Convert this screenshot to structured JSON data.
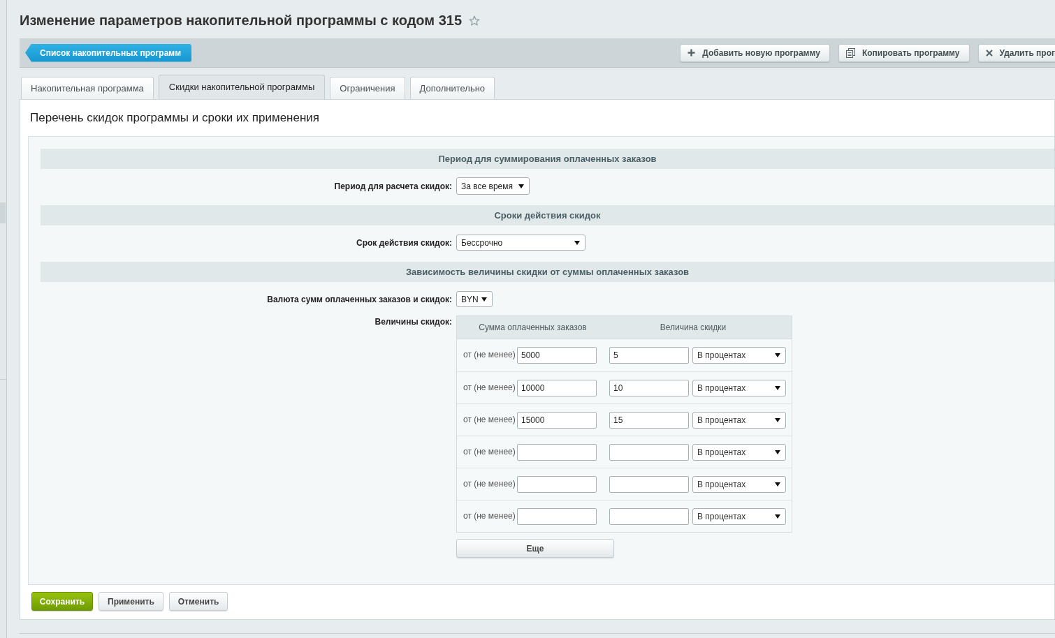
{
  "page": {
    "title": "Изменение параметров накопительной программы с кодом 315"
  },
  "toolbar": {
    "back_button": "Список накопительных программ",
    "actions": [
      {
        "kind": "add",
        "label": "Добавить новую программу"
      },
      {
        "kind": "copy",
        "label": "Копировать программу"
      },
      {
        "kind": "delete",
        "label": "Удалить прог"
      }
    ]
  },
  "tabs": [
    {
      "label": "Накопительная программа",
      "selected": false
    },
    {
      "label": "Скидки накопительной программы",
      "selected": true
    },
    {
      "label": "Ограничения",
      "selected": false
    },
    {
      "label": "Дополнительно",
      "selected": false
    }
  ],
  "panel": {
    "heading": "Перечень скидок программы и сроки их применения",
    "sections": [
      {
        "title": "Период для суммирования оплаченных заказов",
        "fields": [
          {
            "kind": "select",
            "label": "Период для расчета скидок:",
            "value": "За все время"
          }
        ]
      },
      {
        "title": "Сроки действия скидок",
        "fields": [
          {
            "kind": "select",
            "label": "Срок действия скидок:",
            "value": "Бессрочно"
          }
        ]
      },
      {
        "title": "Зависимость величины скидки от суммы оплаченных заказов",
        "fields": [
          {
            "kind": "select",
            "label": "Валюта сумм оплаченных заказов и скидок:",
            "value": "BYN"
          },
          {
            "kind": "table",
            "label": "Величины скидок:",
            "columns": [
              "Сумма оплаченных заказов",
              "Величина скидки"
            ],
            "rows": [
              {
                "prefix": "от (не менее)",
                "amount": "5000",
                "discount": "5",
                "unit": "В процентах"
              },
              {
                "prefix": "от (не менее)",
                "amount": "10000",
                "discount": "10",
                "unit": "В процентах"
              },
              {
                "prefix": "от (не менее)",
                "amount": "15000",
                "discount": "15",
                "unit": "В процентах"
              },
              {
                "prefix": "от (не менее)",
                "unit": "В процентах"
              },
              {
                "prefix": "от (не менее)",
                "unit": "В процентах"
              },
              {
                "prefix": "от (не менее)",
                "unit": "В процентах"
              }
            ],
            "more_button": "Еще"
          }
        ]
      }
    ]
  },
  "form_buttons": [
    {
      "kind": "primary",
      "label": "Сохранить"
    },
    {
      "kind": "secondary",
      "label": "Применить"
    },
    {
      "kind": "secondary",
      "label": "Отменить"
    }
  ]
}
